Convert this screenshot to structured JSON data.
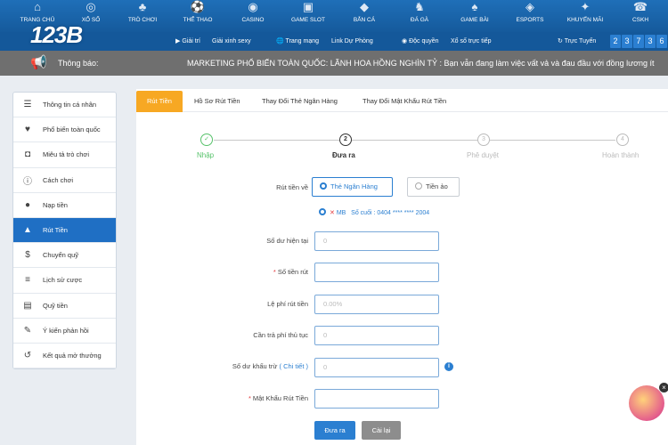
{
  "nav": {
    "items": [
      {
        "label": "TRANG CHỦ",
        "icon": "home-icon",
        "glyph": "⌂"
      },
      {
        "label": "XỔ SỐ",
        "icon": "lottery-icon",
        "glyph": "◎"
      },
      {
        "label": "TRÒ CHƠI",
        "icon": "game-icon",
        "glyph": "♣"
      },
      {
        "label": "THỂ THAO",
        "icon": "sports-icon",
        "glyph": "⚽"
      },
      {
        "label": "CASINO",
        "icon": "casino-icon",
        "glyph": "◉"
      },
      {
        "label": "GAME SLOT",
        "icon": "slot-icon",
        "glyph": "▣"
      },
      {
        "label": "BẮN CÁ",
        "icon": "fish-icon",
        "glyph": "◆"
      },
      {
        "label": "ĐÁ GÀ",
        "icon": "rooster-icon",
        "glyph": "♞"
      },
      {
        "label": "GAME BÀI",
        "icon": "cards-icon",
        "glyph": "♠"
      },
      {
        "label": "ESPORTS",
        "icon": "esports-icon",
        "glyph": "◈"
      },
      {
        "label": "KHUYẾN MÃI",
        "icon": "gift-icon",
        "glyph": "✦"
      },
      {
        "label": "CSKH",
        "icon": "support-icon",
        "glyph": "☎"
      }
    ]
  },
  "subbar": {
    "logo_text": "123B",
    "items": [
      "Giải trí",
      "Giải xinh sexy",
      "Trang mạng",
      "Link Dự Phòng",
      "Độc quyền",
      "Xổ số trực tiếp",
      "Trực Tuyến"
    ],
    "online_digits": [
      "2",
      "3",
      "7",
      "3",
      "6"
    ]
  },
  "notice": {
    "label": "Thông báo:",
    "text": "MARKETING PHỔ BIẾN TOÀN QUỐC:   LÃNH HOA HỒNG NGHÌN TỶ : Bạn vẫn đang làm việc vất vả và đau đầu với đồng lương ít"
  },
  "sidebar": {
    "items": [
      {
        "label": "Thông tin cá nhân",
        "glyph": "☰"
      },
      {
        "label": "Phổ biến toàn quốc",
        "glyph": "♥"
      },
      {
        "label": "Miêu tả trò chơi",
        "glyph": "◘"
      },
      {
        "label": "Cách chơi",
        "glyph": "ⓘ"
      },
      {
        "label": "Nạp tiền",
        "glyph": "●"
      },
      {
        "label": "Rút Tiền",
        "glyph": "▲"
      },
      {
        "label": "Chuyển quỹ",
        "glyph": "$"
      },
      {
        "label": "Lịch sử cược",
        "glyph": "≡"
      },
      {
        "label": "Quỹ tiền",
        "glyph": "▤"
      },
      {
        "label": "Ý kiến phản hồi",
        "glyph": "✎"
      },
      {
        "label": "Kết quả mở thưởng",
        "glyph": "↺"
      }
    ]
  },
  "tabs": [
    "Rút Tiền",
    "Hồ Sơ Rút Tiền",
    "Thay Đổi Thẻ Ngân Hàng",
    "Thay Đổi Mật Khẩu Rút Tiền"
  ],
  "steps": [
    {
      "label": "Nhập",
      "num": "✓"
    },
    {
      "label": "Đưa ra",
      "num": "2"
    },
    {
      "label": "Phê duyệt",
      "num": "3"
    },
    {
      "label": "Hoàn thành",
      "num": "4"
    }
  ],
  "form": {
    "method_label": "Rút tiền về",
    "option_bank": "Thẻ Ngân Hàng",
    "option_virtual": "Tiền ảo",
    "bank_name": "MB",
    "bank_suffix_label": "Số cuối :",
    "bank_number": "0404 **** **** 2004",
    "balance_label": "Số dư hiện tại",
    "balance_value": "0",
    "amount_label": "Số tiền rút",
    "fee_label": "Lệ phí rút tiền",
    "fee_value": "0.00%",
    "fee_pay_label": "Cần trả phí thủ tục",
    "fee_pay_value": "0",
    "deduct_label": "Số dư khấu trừ",
    "deduct_hint": "( Chi tiết )",
    "deduct_value": "0",
    "password_label": "Mật Khẩu Rút Tiền",
    "submit": "Đưa ra",
    "reset": "Cài lại"
  }
}
